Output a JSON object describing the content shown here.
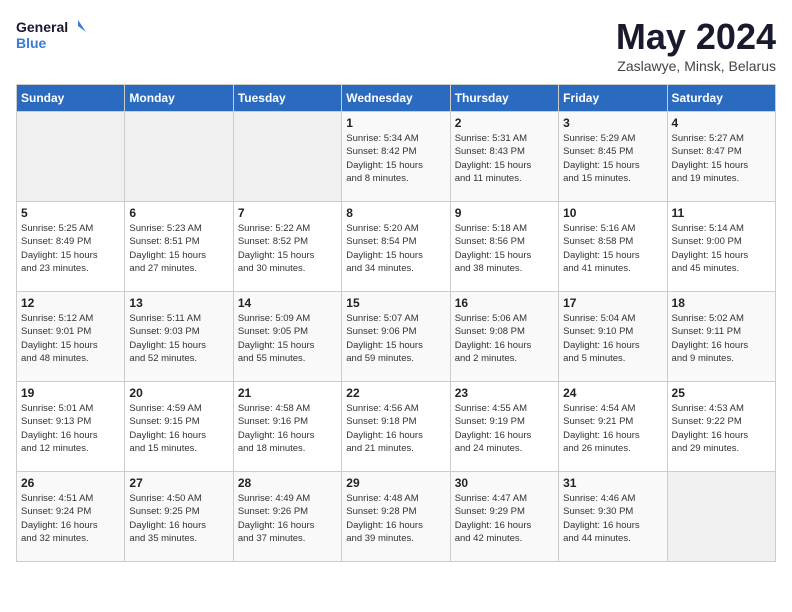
{
  "header": {
    "logo_line1": "General",
    "logo_line2": "Blue",
    "month": "May 2024",
    "location": "Zaslawye, Minsk, Belarus"
  },
  "weekdays": [
    "Sunday",
    "Monday",
    "Tuesday",
    "Wednesday",
    "Thursday",
    "Friday",
    "Saturday"
  ],
  "weeks": [
    [
      {
        "day": "",
        "info": ""
      },
      {
        "day": "",
        "info": ""
      },
      {
        "day": "",
        "info": ""
      },
      {
        "day": "1",
        "info": "Sunrise: 5:34 AM\nSunset: 8:42 PM\nDaylight: 15 hours\nand 8 minutes."
      },
      {
        "day": "2",
        "info": "Sunrise: 5:31 AM\nSunset: 8:43 PM\nDaylight: 15 hours\nand 11 minutes."
      },
      {
        "day": "3",
        "info": "Sunrise: 5:29 AM\nSunset: 8:45 PM\nDaylight: 15 hours\nand 15 minutes."
      },
      {
        "day": "4",
        "info": "Sunrise: 5:27 AM\nSunset: 8:47 PM\nDaylight: 15 hours\nand 19 minutes."
      }
    ],
    [
      {
        "day": "5",
        "info": "Sunrise: 5:25 AM\nSunset: 8:49 PM\nDaylight: 15 hours\nand 23 minutes."
      },
      {
        "day": "6",
        "info": "Sunrise: 5:23 AM\nSunset: 8:51 PM\nDaylight: 15 hours\nand 27 minutes."
      },
      {
        "day": "7",
        "info": "Sunrise: 5:22 AM\nSunset: 8:52 PM\nDaylight: 15 hours\nand 30 minutes."
      },
      {
        "day": "8",
        "info": "Sunrise: 5:20 AM\nSunset: 8:54 PM\nDaylight: 15 hours\nand 34 minutes."
      },
      {
        "day": "9",
        "info": "Sunrise: 5:18 AM\nSunset: 8:56 PM\nDaylight: 15 hours\nand 38 minutes."
      },
      {
        "day": "10",
        "info": "Sunrise: 5:16 AM\nSunset: 8:58 PM\nDaylight: 15 hours\nand 41 minutes."
      },
      {
        "day": "11",
        "info": "Sunrise: 5:14 AM\nSunset: 9:00 PM\nDaylight: 15 hours\nand 45 minutes."
      }
    ],
    [
      {
        "day": "12",
        "info": "Sunrise: 5:12 AM\nSunset: 9:01 PM\nDaylight: 15 hours\nand 48 minutes."
      },
      {
        "day": "13",
        "info": "Sunrise: 5:11 AM\nSunset: 9:03 PM\nDaylight: 15 hours\nand 52 minutes."
      },
      {
        "day": "14",
        "info": "Sunrise: 5:09 AM\nSunset: 9:05 PM\nDaylight: 15 hours\nand 55 minutes."
      },
      {
        "day": "15",
        "info": "Sunrise: 5:07 AM\nSunset: 9:06 PM\nDaylight: 15 hours\nand 59 minutes."
      },
      {
        "day": "16",
        "info": "Sunrise: 5:06 AM\nSunset: 9:08 PM\nDaylight: 16 hours\nand 2 minutes."
      },
      {
        "day": "17",
        "info": "Sunrise: 5:04 AM\nSunset: 9:10 PM\nDaylight: 16 hours\nand 5 minutes."
      },
      {
        "day": "18",
        "info": "Sunrise: 5:02 AM\nSunset: 9:11 PM\nDaylight: 16 hours\nand 9 minutes."
      }
    ],
    [
      {
        "day": "19",
        "info": "Sunrise: 5:01 AM\nSunset: 9:13 PM\nDaylight: 16 hours\nand 12 minutes."
      },
      {
        "day": "20",
        "info": "Sunrise: 4:59 AM\nSunset: 9:15 PM\nDaylight: 16 hours\nand 15 minutes."
      },
      {
        "day": "21",
        "info": "Sunrise: 4:58 AM\nSunset: 9:16 PM\nDaylight: 16 hours\nand 18 minutes."
      },
      {
        "day": "22",
        "info": "Sunrise: 4:56 AM\nSunset: 9:18 PM\nDaylight: 16 hours\nand 21 minutes."
      },
      {
        "day": "23",
        "info": "Sunrise: 4:55 AM\nSunset: 9:19 PM\nDaylight: 16 hours\nand 24 minutes."
      },
      {
        "day": "24",
        "info": "Sunrise: 4:54 AM\nSunset: 9:21 PM\nDaylight: 16 hours\nand 26 minutes."
      },
      {
        "day": "25",
        "info": "Sunrise: 4:53 AM\nSunset: 9:22 PM\nDaylight: 16 hours\nand 29 minutes."
      }
    ],
    [
      {
        "day": "26",
        "info": "Sunrise: 4:51 AM\nSunset: 9:24 PM\nDaylight: 16 hours\nand 32 minutes."
      },
      {
        "day": "27",
        "info": "Sunrise: 4:50 AM\nSunset: 9:25 PM\nDaylight: 16 hours\nand 35 minutes."
      },
      {
        "day": "28",
        "info": "Sunrise: 4:49 AM\nSunset: 9:26 PM\nDaylight: 16 hours\nand 37 minutes."
      },
      {
        "day": "29",
        "info": "Sunrise: 4:48 AM\nSunset: 9:28 PM\nDaylight: 16 hours\nand 39 minutes."
      },
      {
        "day": "30",
        "info": "Sunrise: 4:47 AM\nSunset: 9:29 PM\nDaylight: 16 hours\nand 42 minutes."
      },
      {
        "day": "31",
        "info": "Sunrise: 4:46 AM\nSunset: 9:30 PM\nDaylight: 16 hours\nand 44 minutes."
      },
      {
        "day": "",
        "info": ""
      }
    ]
  ]
}
